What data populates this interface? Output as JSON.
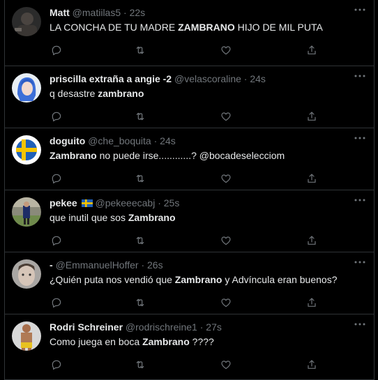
{
  "tweets": [
    {
      "name": "Matt",
      "handle": "@matiilas5",
      "time": "22s",
      "text_parts": [
        {
          "t": "LA CONCHA DE TU MADRE ",
          "b": false
        },
        {
          "t": "ZAMBRANO",
          "b": true
        },
        {
          "t": " HIJO DE MIL PUTA",
          "b": false
        }
      ],
      "avatar": "dark-photo"
    },
    {
      "name": "priscilla extraña a angie -2",
      "handle": "@velascoraline",
      "time": "24s",
      "text_parts": [
        {
          "t": "q desastre ",
          "b": false
        },
        {
          "t": "zambrano",
          "b": true
        }
      ],
      "avatar": "blue-hair-photo"
    },
    {
      "name": "doguito",
      "handle": "@che_boquita",
      "time": "24s",
      "text_parts": [
        {
          "t": "Zambrano",
          "b": true
        },
        {
          "t": " no puede irse............? @bocadeselecciom",
          "b": false
        }
      ],
      "avatar": "swedish-flag-ball"
    },
    {
      "name": "pekee",
      "handle": "@pekeeecabj",
      "time": "25s",
      "name_flag": "sweden-flag",
      "text_parts": [
        {
          "t": "que inutil que sos ",
          "b": false
        },
        {
          "t": "Zambrano",
          "b": true
        }
      ],
      "avatar": "stadium-photo"
    },
    {
      "name": "-",
      "handle": "@EmmanuelHoffer",
      "time": "26s",
      "text_parts": [
        {
          "t": "¿Quién puta nos vendió que ",
          "b": false
        },
        {
          "t": "Zambrano",
          "b": true
        },
        {
          "t": " y Advíncula eran buenos?",
          "b": false
        }
      ],
      "avatar": "face-photo"
    },
    {
      "name": "Rodri Schreiner",
      "handle": "@rodrischreine1",
      "time": "27s",
      "text_parts": [
        {
          "t": "Como juega en boca ",
          "b": false
        },
        {
          "t": "Zambrano",
          "b": true
        },
        {
          "t": " ????",
          "b": false
        }
      ],
      "avatar": "player-photo"
    }
  ],
  "separator": "·",
  "icons": {
    "more": "more-dots-icon",
    "reply": "reply-icon",
    "retweet": "retweet-icon",
    "like": "like-icon",
    "share": "share-icon"
  },
  "colors": {
    "background": "#000000",
    "text": "#e7e9ea",
    "muted": "#71767b",
    "border": "#2f3336"
  }
}
